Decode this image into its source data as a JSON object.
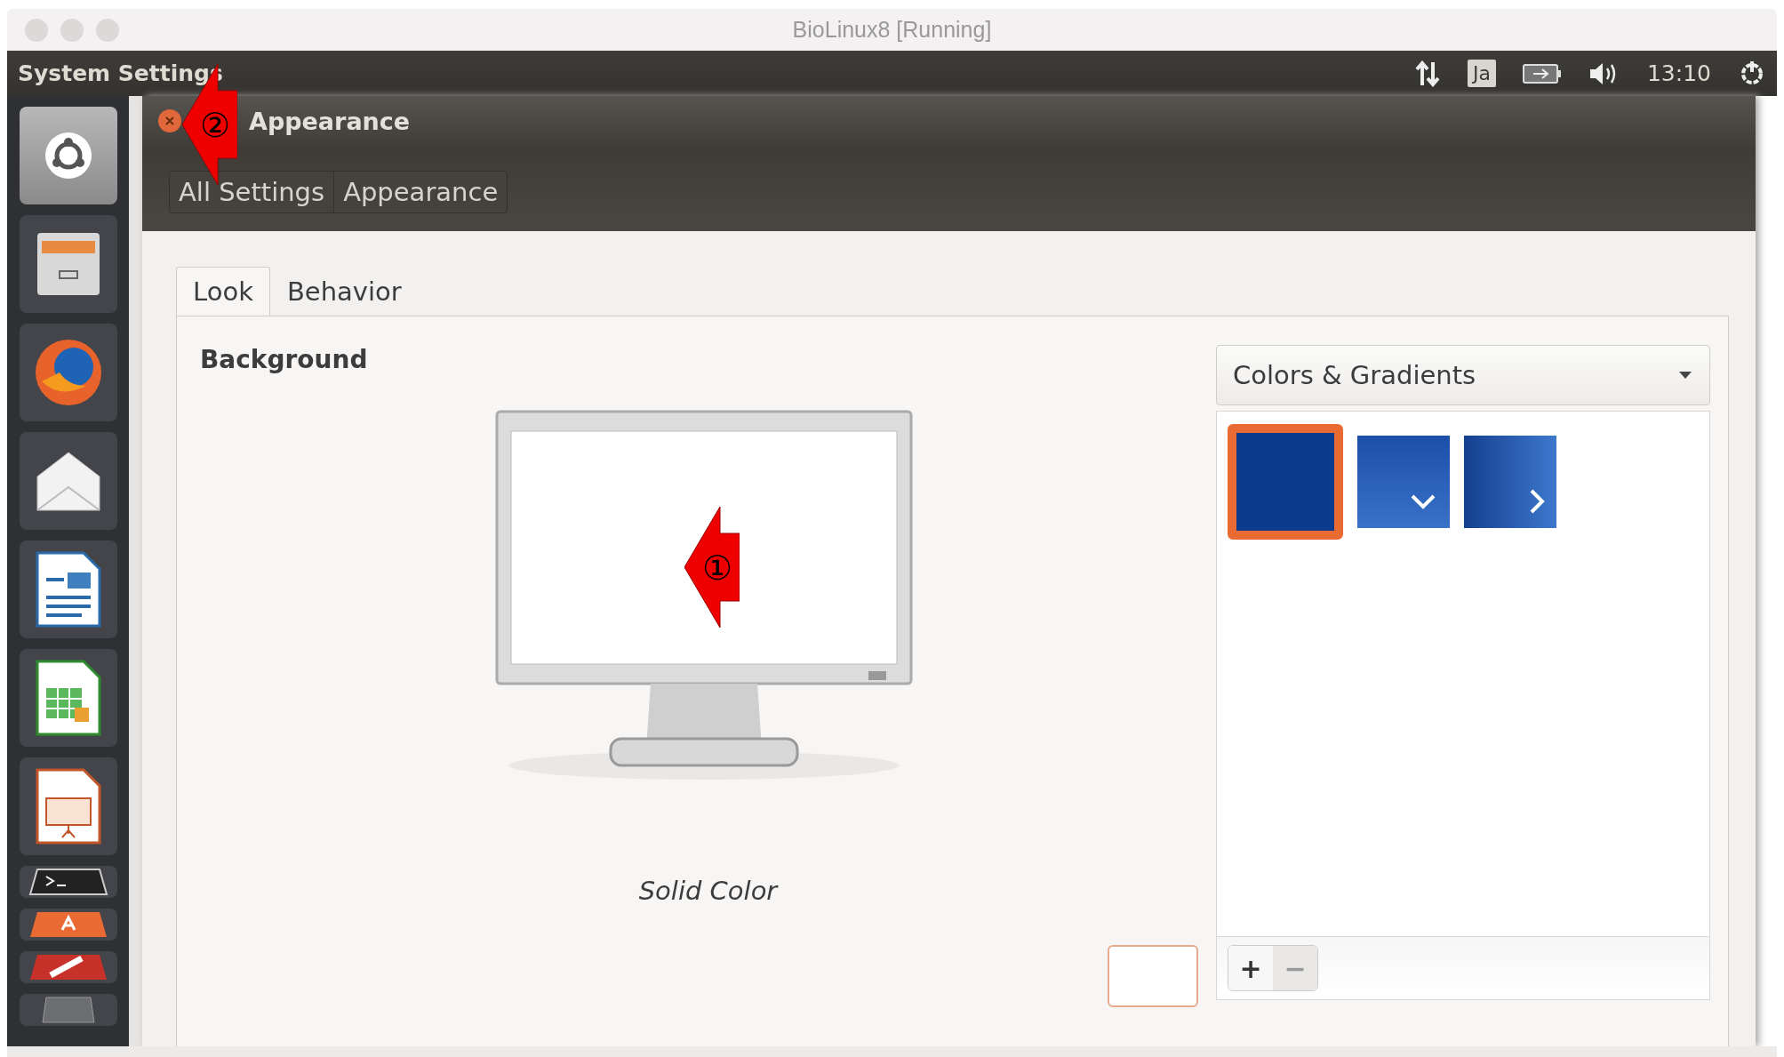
{
  "host_window": {
    "title": "BioLinux8 [Running]"
  },
  "top_panel": {
    "app_name": "System Settings",
    "keyboard_layout": "Ja",
    "time": "13:10"
  },
  "launcher": {
    "items": [
      {
        "kind": "dash",
        "selected": true
      },
      {
        "kind": "files",
        "selected": false
      },
      {
        "kind": "browser",
        "selected": false
      },
      {
        "kind": "mail",
        "selected": false
      },
      {
        "kind": "writer",
        "selected": false
      },
      {
        "kind": "calc",
        "selected": false
      },
      {
        "kind": "impress",
        "selected": false
      },
      {
        "kind": "terminal",
        "selected": false
      },
      {
        "kind": "software",
        "selected": false
      },
      {
        "kind": "settings",
        "selected": false
      },
      {
        "kind": "trash",
        "selected": false
      }
    ]
  },
  "window": {
    "title": "Appearance",
    "breadcrumbs": [
      "All Settings",
      "Appearance"
    ]
  },
  "tabs": [
    {
      "label": "Look",
      "selected": true
    },
    {
      "label": "Behavior",
      "selected": false
    }
  ],
  "background": {
    "heading": "Background",
    "preview_caption": "Solid Color",
    "source_dropdown": "Colors & Gradients",
    "wallpapers": [
      {
        "kind": "solid",
        "selected": true
      },
      {
        "kind": "vertical",
        "selected": false
      },
      {
        "kind": "horizontal",
        "selected": false
      }
    ],
    "buttons": [
      "+",
      "−"
    ]
  },
  "annotations": [
    "②",
    "①"
  ]
}
